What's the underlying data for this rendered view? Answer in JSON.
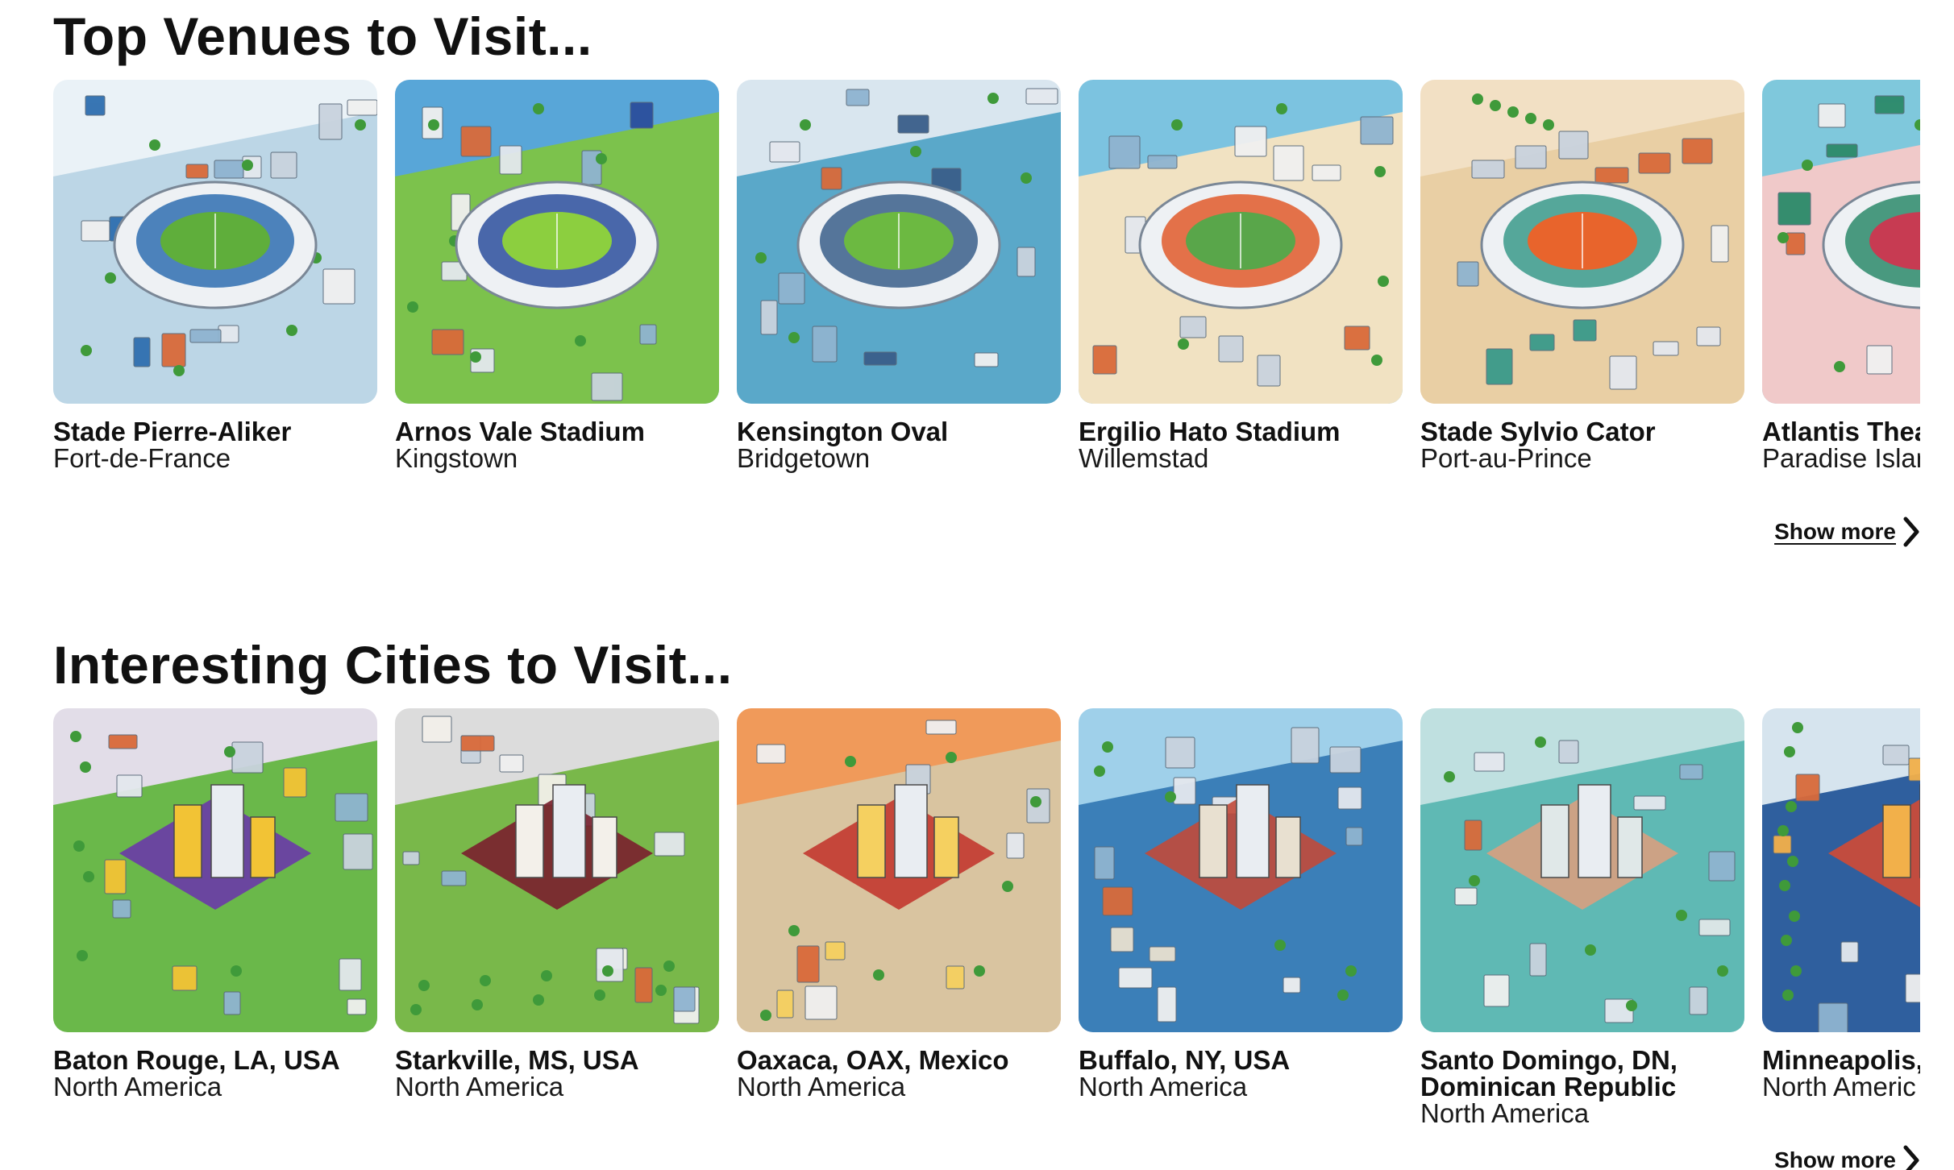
{
  "sections": {
    "venues": {
      "title": "Top Venues to Visit...",
      "show_more_label": "Show more",
      "cards": [
        {
          "title": "Stade Pierre-Aliker",
          "subtitle": "Fort-de-France",
          "image": "isometric-stadium-illustration",
          "sky": "#eaf2f7",
          "ground": "#bcd6e6",
          "pitch": "#5fae3b",
          "accent": "#2f6fb0"
        },
        {
          "title": "Arnos Vale Stadium",
          "subtitle": "Kingstown",
          "image": "isometric-stadium-illustration",
          "sky": "#58a6d8",
          "ground": "#7cc24c",
          "pitch": "#8ccf3f",
          "accent": "#2b4f9c"
        },
        {
          "title": "Kensington Oval",
          "subtitle": "Bridgetown",
          "image": "isometric-stadium-illustration",
          "sky": "#d9e6ef",
          "ground": "#5aa8c9",
          "pitch": "#6cb941",
          "accent": "#3a5f8a"
        },
        {
          "title": "Ergilio Hato Stadium",
          "subtitle": "Willemstad",
          "image": "isometric-stadium-illustration",
          "sky": "#7cc3e0",
          "ground": "#f1e2c2",
          "pitch": "#59a64a",
          "accent": "#e05a2a"
        },
        {
          "title": "Stade Sylvio Cator",
          "subtitle": "Port-au-Prince",
          "image": "isometric-stadium-illustration",
          "sky": "#f2e0c4",
          "ground": "#e9cfa4",
          "pitch": "#e8642c",
          "accent": "#3a9a8a"
        },
        {
          "title": "Atlantis Theat",
          "subtitle": "Paradise Islan",
          "image": "isometric-resort-illustration",
          "sky": "#7fc8dc",
          "ground": "#f0c9c9",
          "pitch": "#c73b52",
          "accent": "#2c8a6a"
        }
      ]
    },
    "cities": {
      "title": "Interesting Cities to Visit...",
      "show_more_label": "Show more",
      "cards": [
        {
          "title": "Baton Rouge, LA, USA",
          "subtitle": "North America",
          "image": "isometric-city-illustration",
          "sky": "#e2dde8",
          "ground": "#6ab84a",
          "pitch": "#6a3aa8",
          "accent": "#f2c335"
        },
        {
          "title": "Starkville, MS, USA",
          "subtitle": "North America",
          "image": "isometric-campus-illustration",
          "sky": "#dcdcdc",
          "ground": "#79b84a",
          "pitch": "#7a1f2e",
          "accent": "#f3f0ea"
        },
        {
          "title": "Oaxaca, OAX, Mexico",
          "subtitle": "North America",
          "image": "isometric-plaza-illustration",
          "sky": "#f09a5a",
          "ground": "#d9c4a0",
          "pitch": "#c2382f",
          "accent": "#f5d060"
        },
        {
          "title": "Buffalo, NY, USA",
          "subtitle": "North America",
          "image": "aerial-city-illustration",
          "sky": "#9fd0ea",
          "ground": "#3b7fb8",
          "pitch": "#c24a3a",
          "accent": "#e8e0d0"
        },
        {
          "title": "Santo Domingo, DN,",
          "title_line2": "Dominican Republic",
          "subtitle": "North America",
          "image": "isometric-coastal-city-illustration",
          "sky": "#bfe0e0",
          "ground": "#5fb9b4",
          "pitch": "#d8a080",
          "accent": "#e0e8e8"
        },
        {
          "title": "Minneapolis, I",
          "subtitle": "North Americ",
          "image": "aerial-city-illustration",
          "sky": "#d6e4ee",
          "ground": "#2f5f9e",
          "pitch": "#d24a34",
          "accent": "#f2b04a"
        }
      ]
    }
  }
}
